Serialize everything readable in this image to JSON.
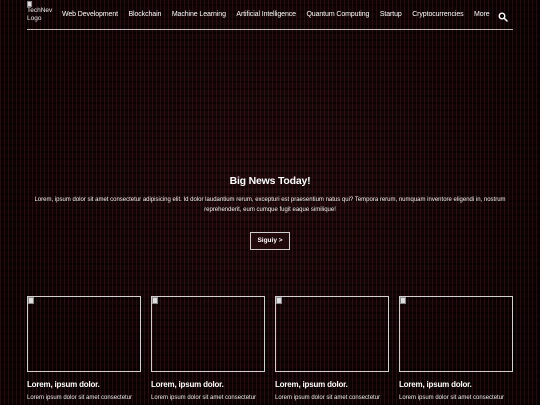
{
  "logo": {
    "alt_text": "TechNev Logo"
  },
  "nav": {
    "items": [
      "Web Development",
      "Blockchain",
      "Machine Learning",
      "Artificial Intelligence",
      "Quantum Computing",
      "Startup",
      "Cryptocurrencies",
      "More"
    ],
    "search_icon": "search-icon"
  },
  "hero": {
    "title": "Big News Today!",
    "text": "Lorem, ipsum dolor sit amet consectetur adipisicing elit. Id dolor laudantium rerum, excepturi est praesentium natus qui? Tempora rerum, numquam inventore eligendi in, nostrum reprehenderit, eum cumque fugit eaque similique!",
    "button_label": "Siguiy >"
  },
  "cards": [
    {
      "title": "Lorem, ipsum dolor.",
      "text": "Lorem ipsum dolor sit amet consectetur"
    },
    {
      "title": "Lorem, ipsum dolor.",
      "text": "Lorem ipsum dolor sit amet consectetur"
    },
    {
      "title": "Lorem, ipsum dolor.",
      "text": "Lorem ipsum dolor sit amet consectetur"
    },
    {
      "title": "Lorem, ipsum dolor.",
      "text": "Lorem ipsum dolor sit amet consectetur"
    }
  ]
}
